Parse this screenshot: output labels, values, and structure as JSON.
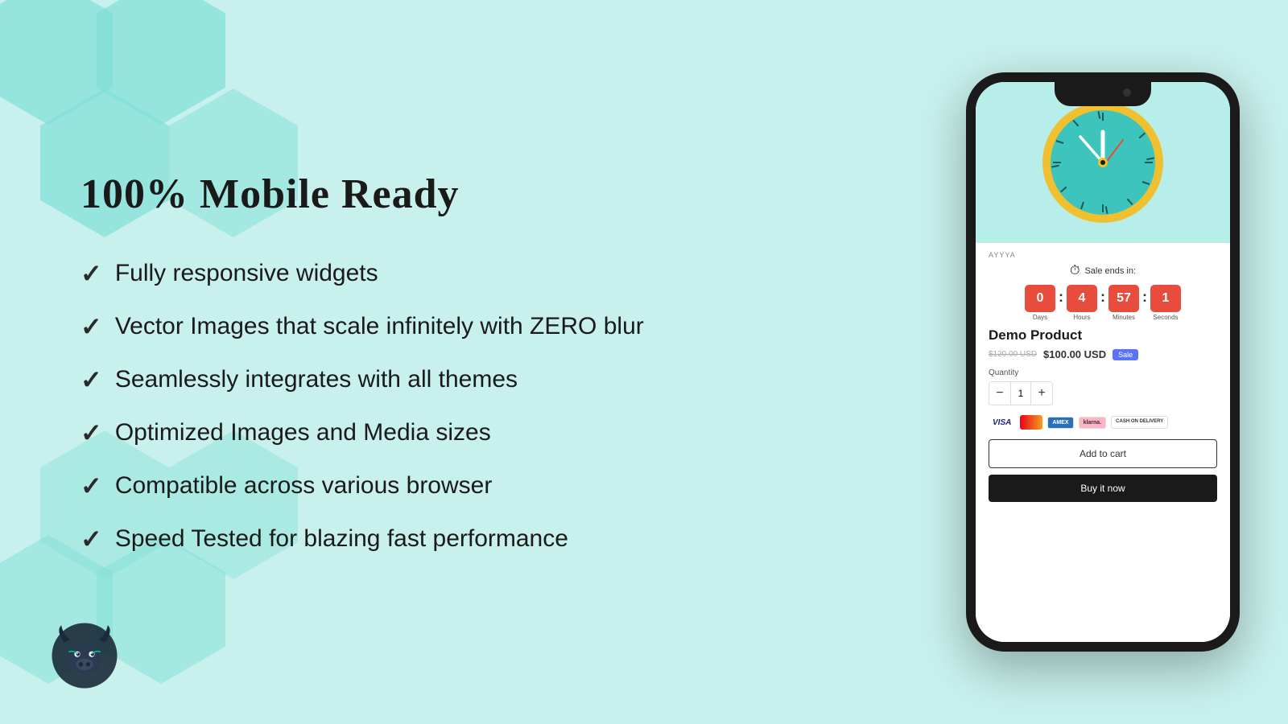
{
  "page": {
    "title": "100% Mobile Ready",
    "background_color": "#c8f0ec"
  },
  "features": {
    "items": [
      {
        "id": 1,
        "text": "Fully responsive widgets"
      },
      {
        "id": 2,
        "text": "Vector Images that scale infinitely with ZERO blur"
      },
      {
        "id": 3,
        "text": "Seamlessly integrates with all themes"
      },
      {
        "id": 4,
        "text": "Optimized Images and Media sizes"
      },
      {
        "id": 5,
        "text": "Compatible across various browser"
      },
      {
        "id": 6,
        "text": "Speed Tested for blazing fast performance"
      }
    ],
    "checkmark": "✓"
  },
  "phone": {
    "brand": "AYYYA",
    "sale_header": "Sale ends in:",
    "countdown": {
      "days": {
        "value": "0",
        "label": "Days"
      },
      "hours": {
        "value": "4",
        "label": "Hours"
      },
      "minutes": {
        "value": "57",
        "label": "Minutes"
      },
      "seconds": {
        "value": "1",
        "label": "Seconds"
      }
    },
    "product": {
      "title": "Demo Product",
      "price_old": "$120.00 USD",
      "price_new": "$100.00 USD",
      "sale_badge": "Sale",
      "quantity_label": "Quantity",
      "quantity_value": "1",
      "qty_minus": "−",
      "qty_plus": "+"
    },
    "payment": {
      "visa": "VISA",
      "mastercard": "MC",
      "amex": "AMEX",
      "klarna": "klarna",
      "cod": "CASH ON\nDELIVERY"
    },
    "buttons": {
      "add_to_cart": "Add to cart",
      "buy_now": "Buy it now"
    }
  }
}
